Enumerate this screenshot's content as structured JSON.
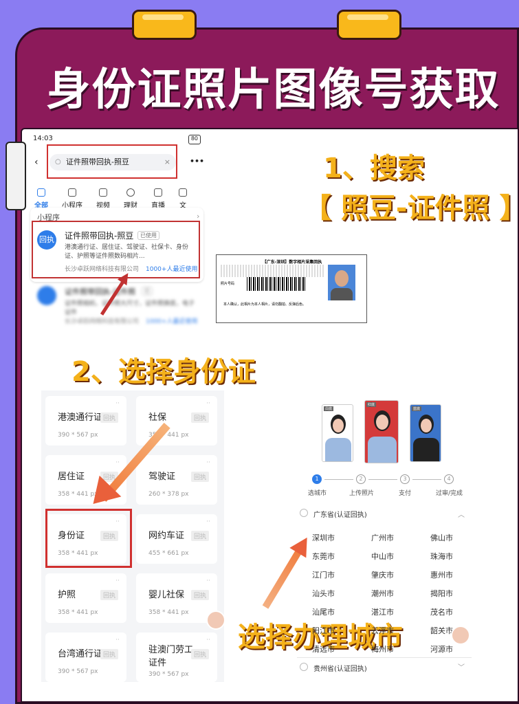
{
  "title": "身份证照片图像号获取",
  "steps": {
    "s1": "1、搜索",
    "s1b": "【 照豆-证件照 】",
    "s2": "2、选择身份证",
    "s3": "3、选择办理城市"
  },
  "phone": {
    "time": "14:03",
    "battery": "80",
    "search_value": "证件照带回执-照豆",
    "more": "•••",
    "tabs": [
      "全部",
      "小程序",
      "视频",
      "理财",
      "直播",
      "文"
    ],
    "section": "小程序",
    "result": {
      "logo": "回执",
      "name": "证件照带回执-照豆",
      "badge": "已使用",
      "desc": "港澳通行证、居住证、驾驶证、社保卡、身份证、护照等证件照数码相片...",
      "company": "长沙卓跃网络科技有限公司",
      "users": "1000+人最近使用"
    },
    "result2": {
      "name": "证件照带回执-证件照",
      "badge": "已",
      "desc": "证件照相机、证件照大尺寸，证件照换底，电子证件",
      "company": "长沙卓跃网络科技有限公司",
      "users": "1000+人最近使用"
    }
  },
  "doc": {
    "header": "【广东-深圳】数字相片采集回执",
    "footer": "本人确认，此相片为本人相片，请勿翻拍、反弹后色。",
    "code_label": "照片号码"
  },
  "grid": [
    {
      "name": "港澳通行证",
      "size": "390 * 567 px",
      "tag": "回执"
    },
    {
      "name": "社保",
      "size": "358 * 441 px",
      "tag": "回执"
    },
    {
      "name": "居住证",
      "size": "358 * 441 px",
      "tag": "回执"
    },
    {
      "name": "驾驶证",
      "size": "260 * 378 px",
      "tag": "回执"
    },
    {
      "name": "身份证",
      "size": "358 * 441 px",
      "tag": "回执"
    },
    {
      "name": "网约车证",
      "size": "455 * 661 px",
      "tag": "回执"
    },
    {
      "name": "护照",
      "size": "358 * 441 px",
      "tag": "回执"
    },
    {
      "name": "婴儿社保",
      "size": "358 * 441 px",
      "tag": "回执"
    },
    {
      "name": "台湾通行证",
      "size": "390 * 567 px",
      "tag": "回执"
    },
    {
      "name": "驻澳门劳工证件",
      "size": "390 * 567 px",
      "tag": "回执"
    }
  ],
  "photos": [
    "白底",
    "红底",
    "蓝底"
  ],
  "stepper": [
    "选城市",
    "上传照片",
    "支付",
    "过审/完成"
  ],
  "province": "广东省(认证回执)",
  "province2": "贵州省(认证回执)",
  "cities": [
    "深圳市",
    "广州市",
    "佛山市",
    "东莞市",
    "中山市",
    "珠海市",
    "江门市",
    "肇庆市",
    "惠州市",
    "汕头市",
    "潮州市",
    "揭阳市",
    "汕尾市",
    "湛江市",
    "茂名市",
    "阳江市",
    "云浮市",
    "韶关市",
    "清远市",
    "梅州市",
    "河源市"
  ],
  "colors": {
    "bg": "#8a7cf2",
    "board": "#8c1a5a",
    "accent": "#f4b11a",
    "red": "#c13232",
    "blue": "#2e7de9"
  }
}
